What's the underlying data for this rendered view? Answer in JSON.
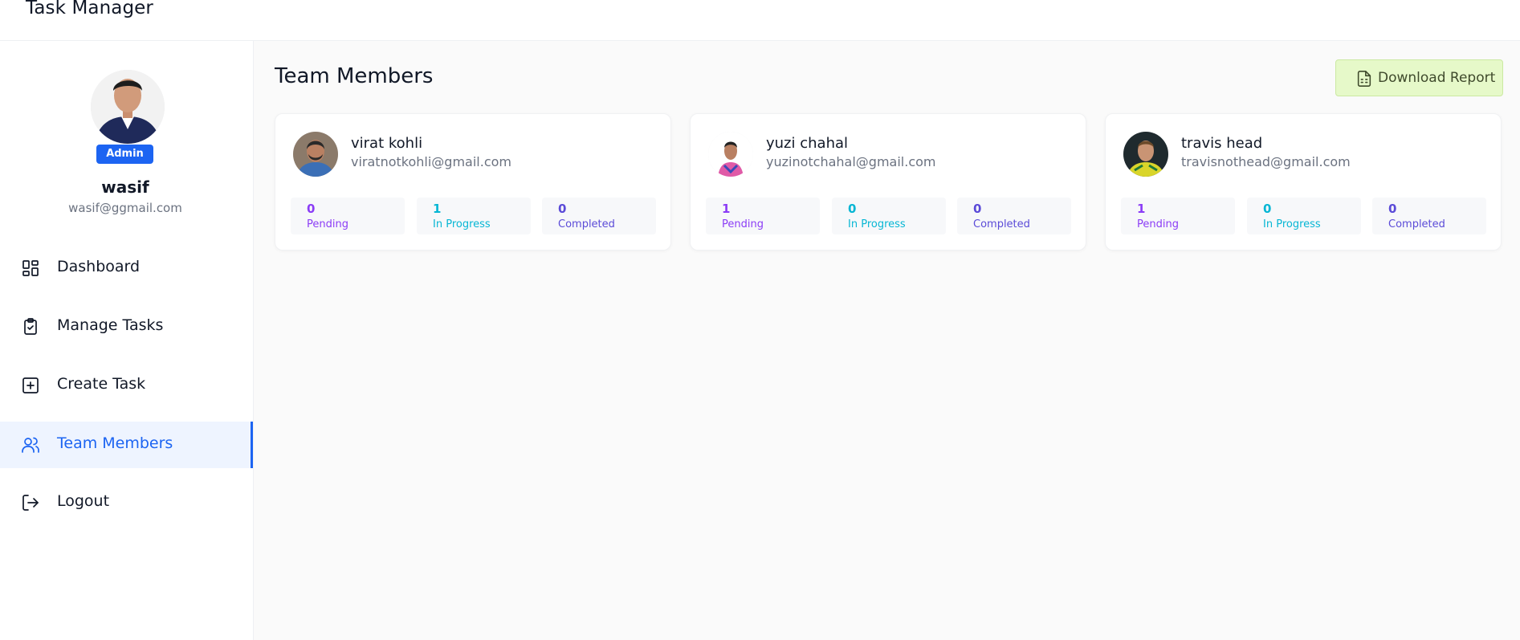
{
  "app": {
    "title": "Task Manager"
  },
  "user": {
    "name": "wasif",
    "email": "wasif@ggmail.com",
    "role_badge": "Admin"
  },
  "sidebar": {
    "items": [
      {
        "label": "Dashboard",
        "icon": "dashboard-grid-icon",
        "active": false
      },
      {
        "label": "Manage Tasks",
        "icon": "clipboard-check-icon",
        "active": false
      },
      {
        "label": "Create Task",
        "icon": "plus-square-icon",
        "active": false
      },
      {
        "label": "Team Members",
        "icon": "users-icon",
        "active": true
      },
      {
        "label": "Logout",
        "icon": "logout-icon",
        "active": false
      }
    ]
  },
  "main": {
    "title": "Team Members",
    "download_button": {
      "label": "Download Report",
      "icon": "file-spreadsheet-icon"
    },
    "members": [
      {
        "name": "virat kohli",
        "email": "viratnotkohli@gmail.com",
        "stats": [
          {
            "value": "0",
            "label": "Pending"
          },
          {
            "value": "1",
            "label": "In Progress"
          },
          {
            "value": "0",
            "label": "Completed"
          }
        ]
      },
      {
        "name": "yuzi chahal",
        "email": "yuzinotchahal@gmail.com",
        "stats": [
          {
            "value": "1",
            "label": "Pending"
          },
          {
            "value": "0",
            "label": "In Progress"
          },
          {
            "value": "0",
            "label": "Completed"
          }
        ]
      },
      {
        "name": "travis head",
        "email": "travisnothead@gmail.com",
        "stats": [
          {
            "value": "1",
            "label": "Pending"
          },
          {
            "value": "0",
            "label": "In Progress"
          },
          {
            "value": "0",
            "label": "Completed"
          }
        ]
      }
    ]
  },
  "colors": {
    "accent": "#1c64f2",
    "pending": "#8b3cf6",
    "in_progress": "#06b6d4",
    "completed": "#5b4bd8",
    "download_bg": "#e6f9c9"
  }
}
